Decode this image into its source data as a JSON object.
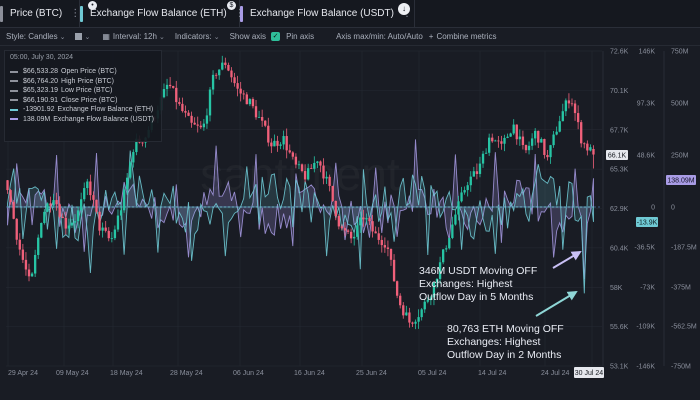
{
  "tabs": [
    {
      "label": "Price (BTC)",
      "color": "#8c8f9a"
    },
    {
      "label": "Exchange Flow Balance (ETH)",
      "color": "#6fc9d4"
    },
    {
      "label": "Exchange Flow Balance (USDT)",
      "color": "#a99ce6"
    }
  ],
  "tab_icons": [
    "dots-icon",
    "lock-icon",
    "dollar-icon",
    "download-icon"
  ],
  "toolbar": {
    "style": "Style: Candles",
    "interval": "Interval: 12h",
    "indicators": "Indicators:",
    "show_axis": "Show axis",
    "pin_axis": "Pin axis",
    "axis_maxmin": "Axis max/min: Auto/Auto",
    "combine": "Combine metrics"
  },
  "tooltip": {
    "date": "05:00, July 30, 2024",
    "rows": [
      {
        "value": "$66,533.28",
        "label": "Open Price (BTC)",
        "color": "#8f929c"
      },
      {
        "value": "$66,764.20",
        "label": "High Price (BTC)",
        "color": "#8f929c"
      },
      {
        "value": "$65,323.19",
        "label": "Low Price (BTC)",
        "color": "#8f929c"
      },
      {
        "value": "$66,190.91",
        "label": "Close Price (BTC)",
        "color": "#8f929c"
      },
      {
        "value": "-13901.92",
        "label": "Exchange Flow Balance (ETH)",
        "color": "#6fc9d4"
      },
      {
        "value": "138.09M",
        "label": "Exchange Flow Balance (USDT)",
        "color": "#a99ce6"
      }
    ]
  },
  "axes": {
    "price_ticks": [
      "72.6K",
      "70.1K",
      "67.7K",
      "65.3K",
      "62.9K",
      "60.4K",
      "58K",
      "55.6K",
      "53.1K"
    ],
    "price_badge": "66.1K",
    "eth_ticks": [
      "146K",
      "97.3K",
      "48.6K",
      "0",
      "-36.5K",
      "-73K",
      "-109K",
      "-146K"
    ],
    "eth_badge": "-13.9K",
    "usdt_ticks": [
      "750M",
      "500M",
      "250M",
      "0",
      "-187.5M",
      "-375M",
      "-562.5M",
      "-750M"
    ],
    "usdt_badge": "138.09M",
    "x_ticks": [
      "29 Apr 24",
      "09 May 24",
      "18 May 24",
      "28 May 24",
      "06 Jun 24",
      "16 Jun 24",
      "25 Jun 24",
      "05 Jul 24",
      "14 Jul 24",
      "24 Jul 24"
    ],
    "x_badge": "30 Jul 24"
  },
  "watermark": "santiment",
  "annotations": {
    "usdt": [
      "346M USDT Moving OFF",
      "Exchanges: Highest",
      "Outflow Day in 5 Months"
    ],
    "eth": [
      "80,763 ETH Moving OFF",
      "Exchanges: Highest",
      "Outflow Day in 2 Months"
    ]
  },
  "colors": {
    "up": "#27c5a5",
    "down": "#f0607a",
    "eth": "#6fc9d4",
    "usdt": "#a99ce6",
    "arrow": "#8fd6d6"
  },
  "chart_data": {
    "type": "candlestick",
    "x_range": [
      "2024-04-26",
      "2024-07-30"
    ],
    "price": {
      "name": "Price (BTC)",
      "unit": "USD",
      "y_range": [
        53100,
        72600
      ],
      "close_path": [
        64200,
        60500,
        58000,
        62500,
        63700,
        61800,
        62300,
        64500,
        61700,
        60800,
        63200,
        66800,
        67300,
        69000,
        70600,
        69100,
        68000,
        67700,
        71200,
        71900,
        70200,
        69500,
        68300,
        66800,
        67200,
        65500,
        64800,
        66000,
        64100,
        61600,
        60900,
        62400,
        61200,
        60700,
        57200,
        55800,
        56500,
        57900,
        60200,
        62500,
        64500,
        65200,
        67400,
        66600,
        68100,
        66200,
        67600,
        65900,
        68300,
        69900,
        67000,
        66190.91
      ]
    },
    "eth_flow": {
      "name": "Exchange Flow Balance (ETH)",
      "unit": "ETH",
      "y_range": [
        -146000,
        146000
      ],
      "outflow_peak": -80763
    },
    "usdt_flow": {
      "name": "Exchange Flow Balance (USDT)",
      "unit": "USDT",
      "y_range": [
        -750000000,
        750000000
      ],
      "outflow_peak": -346000000
    },
    "last": {
      "open": 66533.28,
      "high": 66764.2,
      "low": 65323.19,
      "close": 66190.91,
      "eth": -13901.92,
      "usdt": 138090000
    }
  }
}
